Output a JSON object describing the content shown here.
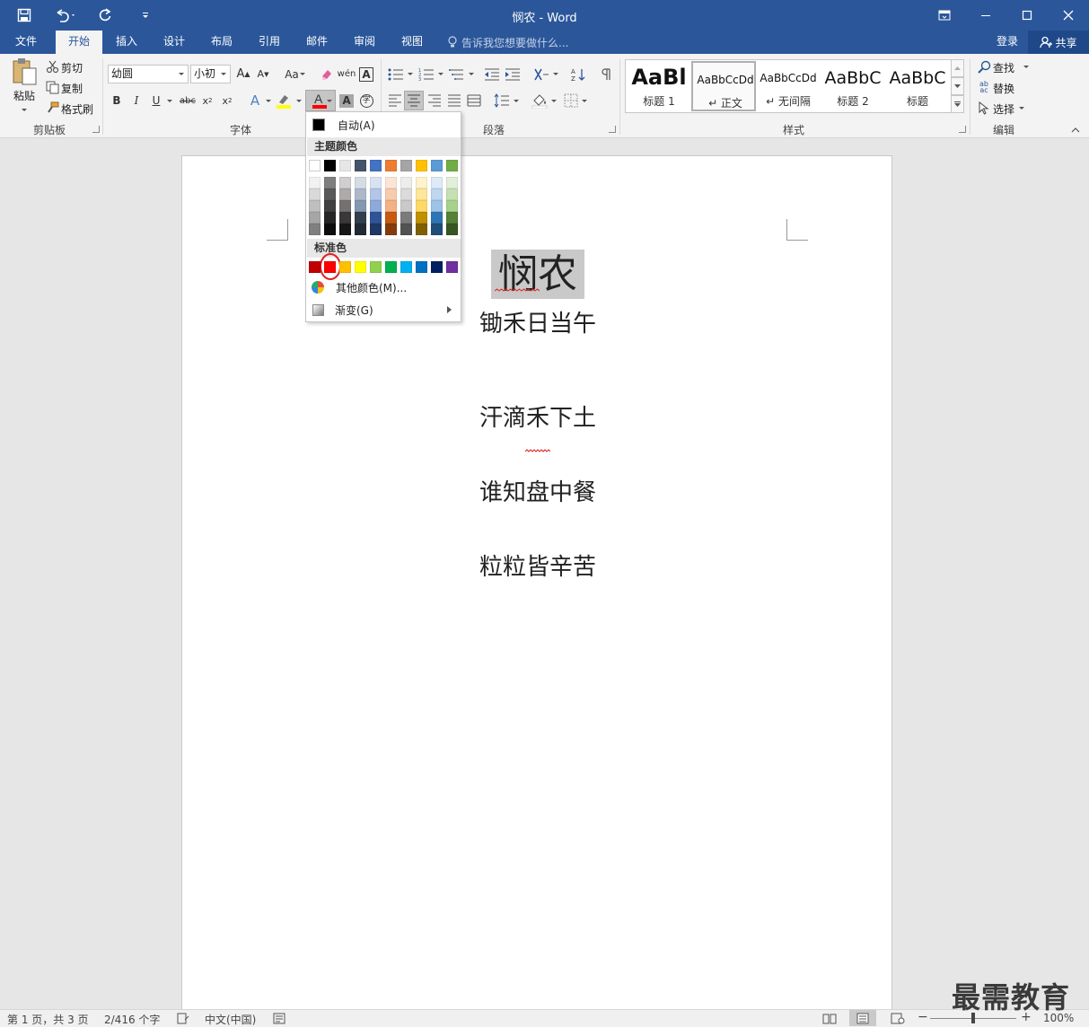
{
  "window": {
    "title": "悯农 - Word"
  },
  "tabs": [
    {
      "label": "文件",
      "active": false
    },
    {
      "label": "开始",
      "active": true
    },
    {
      "label": "插入",
      "active": false
    },
    {
      "label": "设计",
      "active": false
    },
    {
      "label": "布局",
      "active": false
    },
    {
      "label": "引用",
      "active": false
    },
    {
      "label": "邮件",
      "active": false
    },
    {
      "label": "审阅",
      "active": false
    },
    {
      "label": "视图",
      "active": false
    }
  ],
  "tell_me": {
    "placeholder": "告诉我您想要做什么..."
  },
  "account": {
    "login": "登录",
    "share": "共享"
  },
  "ribbon": {
    "clipboard": {
      "group": "剪贴板",
      "paste": "粘贴",
      "cut": "剪切",
      "copy": "复制",
      "format_painter": "格式刷"
    },
    "font": {
      "group": "字体",
      "font_name": "幼圆",
      "font_size": "小初",
      "change_case": "Aa"
    },
    "paragraph": {
      "group": "段落"
    },
    "styles": {
      "group": "样式",
      "items": [
        {
          "sample": "AaBl",
          "name": "标题 1"
        },
        {
          "sample": "AaBbCcDd",
          "name": "↵ 正文"
        },
        {
          "sample": "AaBbCcDd",
          "name": "↵ 无间隔"
        },
        {
          "sample": "AaBbC",
          "name": "标题 2"
        },
        {
          "sample": "AaBbC",
          "name": "标题"
        }
      ]
    },
    "editing": {
      "group": "编辑",
      "find": "查找",
      "replace": "替换",
      "select": "选择"
    }
  },
  "font_color_menu": {
    "automatic": "自动(A)",
    "theme_colors_label": "主题颜色",
    "standard_colors_label": "标准色",
    "more_colors": "其他颜色(M)...",
    "gradient": "渐变(G)",
    "theme_row": [
      "#FFFFFF",
      "#000000",
      "#E7E6E6",
      "#44546A",
      "#4472C4",
      "#ED7D31",
      "#A5A5A5",
      "#FFC000",
      "#5B9BD5",
      "#70AD47"
    ],
    "theme_shades": [
      [
        "#F2F2F2",
        "#D9D9D9",
        "#BFBFBF",
        "#A6A6A6",
        "#808080"
      ],
      [
        "#7F7F7F",
        "#595959",
        "#404040",
        "#262626",
        "#0D0D0D"
      ],
      [
        "#D0CECE",
        "#AEAAAA",
        "#757171",
        "#3A3838",
        "#171616"
      ],
      [
        "#D6DCE4",
        "#ADB9CA",
        "#8497B0",
        "#333F4F",
        "#222A35"
      ],
      [
        "#D9E2F3",
        "#B4C6E7",
        "#8EAADB",
        "#2F5496",
        "#1F3864"
      ],
      [
        "#FBE5D5",
        "#F7CBAC",
        "#F4B183",
        "#C55A11",
        "#843C0B"
      ],
      [
        "#EDEDED",
        "#DBDBDB",
        "#C9C9C9",
        "#7B7B7B",
        "#525252"
      ],
      [
        "#FFF2CC",
        "#FFE699",
        "#FFD966",
        "#BF9000",
        "#7F6000"
      ],
      [
        "#DEEBF6",
        "#BDD7EE",
        "#9DC3E6",
        "#2E75B5",
        "#1F4E79"
      ],
      [
        "#E2EFD9",
        "#C5E0B3",
        "#A8D08D",
        "#538135",
        "#375623"
      ]
    ],
    "standard_row": [
      "#C00000",
      "#FF0000",
      "#FFC000",
      "#FFFF00",
      "#92D050",
      "#00B050",
      "#00B0F0",
      "#0070C0",
      "#002060",
      "#7030A0"
    ],
    "highlighted_standard_index": 1
  },
  "document": {
    "title": "悯农",
    "lines": [
      "锄禾日当午",
      "汗滴禾下土",
      "谁知盘中餐",
      "粒粒皆辛苦"
    ]
  },
  "status": {
    "page": "第 1 页，共 3 页",
    "words": "2/416 个字",
    "language": "中文(中国)",
    "zoom": "100%",
    "zoom_level": 0.5
  },
  "watermark": "最需教育",
  "colors": {
    "accent": "#2B579A",
    "share_bg": "#1F4889",
    "highlight_ring": "#E0201F"
  }
}
